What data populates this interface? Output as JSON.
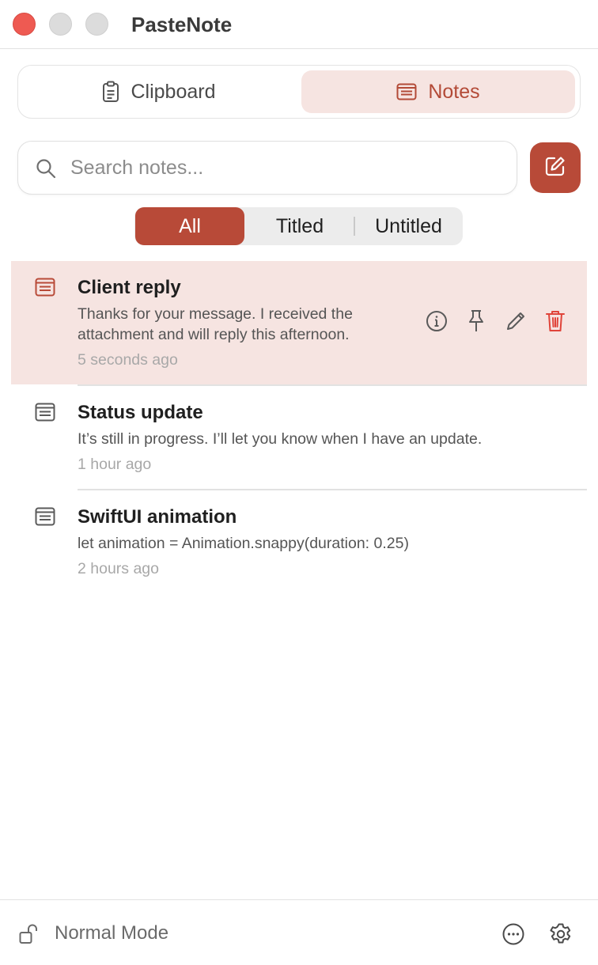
{
  "window": {
    "title": "PasteNote"
  },
  "tabs": [
    {
      "label": "Clipboard",
      "icon": "clipboard-icon",
      "selected": false
    },
    {
      "label": "Notes",
      "icon": "note-icon",
      "selected": true
    }
  ],
  "search": {
    "placeholder": "Search notes...",
    "value": ""
  },
  "compose": {
    "icon": "compose-icon"
  },
  "filter": {
    "options": [
      "All",
      "Titled",
      "Untitled"
    ],
    "selected": "All"
  },
  "notes": [
    {
      "title": "Client reply",
      "body": "Thanks for your message. I received the attachment and will reply this afternoon.",
      "time": "5 seconds ago",
      "selected": true,
      "actions": [
        "info-icon",
        "pin-icon",
        "pencil-icon",
        "trash-icon"
      ]
    },
    {
      "title": "Status update",
      "body": "It’s still in progress. I’ll let you know when I have an update.",
      "time": "1 hour ago",
      "selected": false
    },
    {
      "title": "SwiftUI animation",
      "body": "let animation = Animation.snappy(duration: 0.25)",
      "time": "2 hours ago",
      "selected": false
    }
  ],
  "footer": {
    "mode_label": "Normal Mode",
    "lock_icon": "unlock-icon",
    "more_icon": "ellipsis-circle-icon",
    "settings_icon": "gear-icon"
  },
  "colors": {
    "accent": "#b84a38",
    "accent_light": "#f6e4e1",
    "danger": "#e0443a"
  }
}
